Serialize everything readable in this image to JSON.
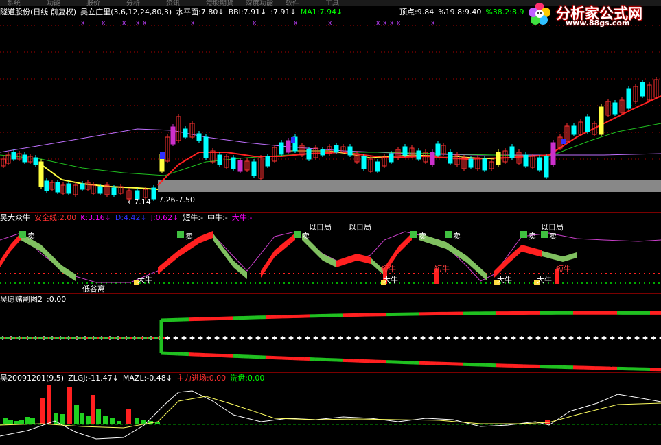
{
  "menu": [
    "系统",
    "功能",
    "报价",
    "分析",
    "资讯",
    "港股期货",
    "深度功能",
    "软件",
    "工具"
  ],
  "watermark": {
    "title": "分析家公式网",
    "url": "www.88gs.com"
  },
  "panel1": {
    "title": "隧道股份(日线 前复权)",
    "indicator": "吴立庄里(3,6,12,24,80,3)",
    "items": [
      {
        "label": "水平面:7.80",
        "color": "#ffffff",
        "arrow": "↓"
      },
      {
        "label": "BBI:7.91",
        "color": "#ffffff",
        "arrow": "↓"
      },
      {
        "label": ":7.91",
        "color": "#ffffff",
        "arrow": "↓"
      },
      {
        "label": "MA1:7.94",
        "color": "#00ff00",
        "arrow": "↓"
      }
    ],
    "right_items": [
      {
        "label": "顶点:9.84",
        "color": "#ffffff"
      },
      {
        "label": "%19.8:9.40",
        "color": "#ffffff"
      },
      {
        "label": "%38.2:8.9",
        "color": "#00ff00"
      }
    ],
    "low_label": "←7.14",
    "range_label": "7.26-7.50"
  },
  "panel2": {
    "title": "吴大众牛",
    "items": [
      {
        "label": "安全线:2.00",
        "color": "#ff3030"
      },
      {
        "label": "K:3.16",
        "color": "#ff00ff",
        "arrow": "↓"
      },
      {
        "label": "D:4.42",
        "color": "#3030ff",
        "arrow": "↓"
      },
      {
        "label": "J:0.62",
        "color": "#ff00ff",
        "arrow": "↓"
      },
      {
        "label": "短牛:-",
        "color": "#ffffff"
      },
      {
        "label": "中牛:-",
        "color": "#ffffff"
      },
      {
        "label": "大牛:-",
        "color": "#ff00ff"
      }
    ],
    "signals": {
      "sell": "卖",
      "bull": "大牛",
      "short_bull": "短牛",
      "top": "以目局",
      "bottom": "低谷离"
    }
  },
  "panel3": {
    "title": "吴愿赌副图2",
    "value": ":0.00"
  },
  "panel4": {
    "title": "吴20091201(9,5)",
    "items": [
      {
        "label": "ZLGJ:-11.47",
        "color": "#ffffff",
        "arrow": "↓"
      },
      {
        "label": "MAZL:-0.48",
        "color": "#ffffff",
        "arrow": "↓"
      },
      {
        "label": "主力进场:0.00",
        "color": "#ff3030"
      },
      {
        "label": "洗盘:0.00",
        "color": "#00ff00"
      }
    ]
  },
  "colors": {
    "up": "#ff3030",
    "down": "#00ffff",
    "ma_red": "#e00000",
    "ma_green": "#00b000",
    "ma_purple": "#c070ff",
    "yellow": "#ffff40"
  }
}
